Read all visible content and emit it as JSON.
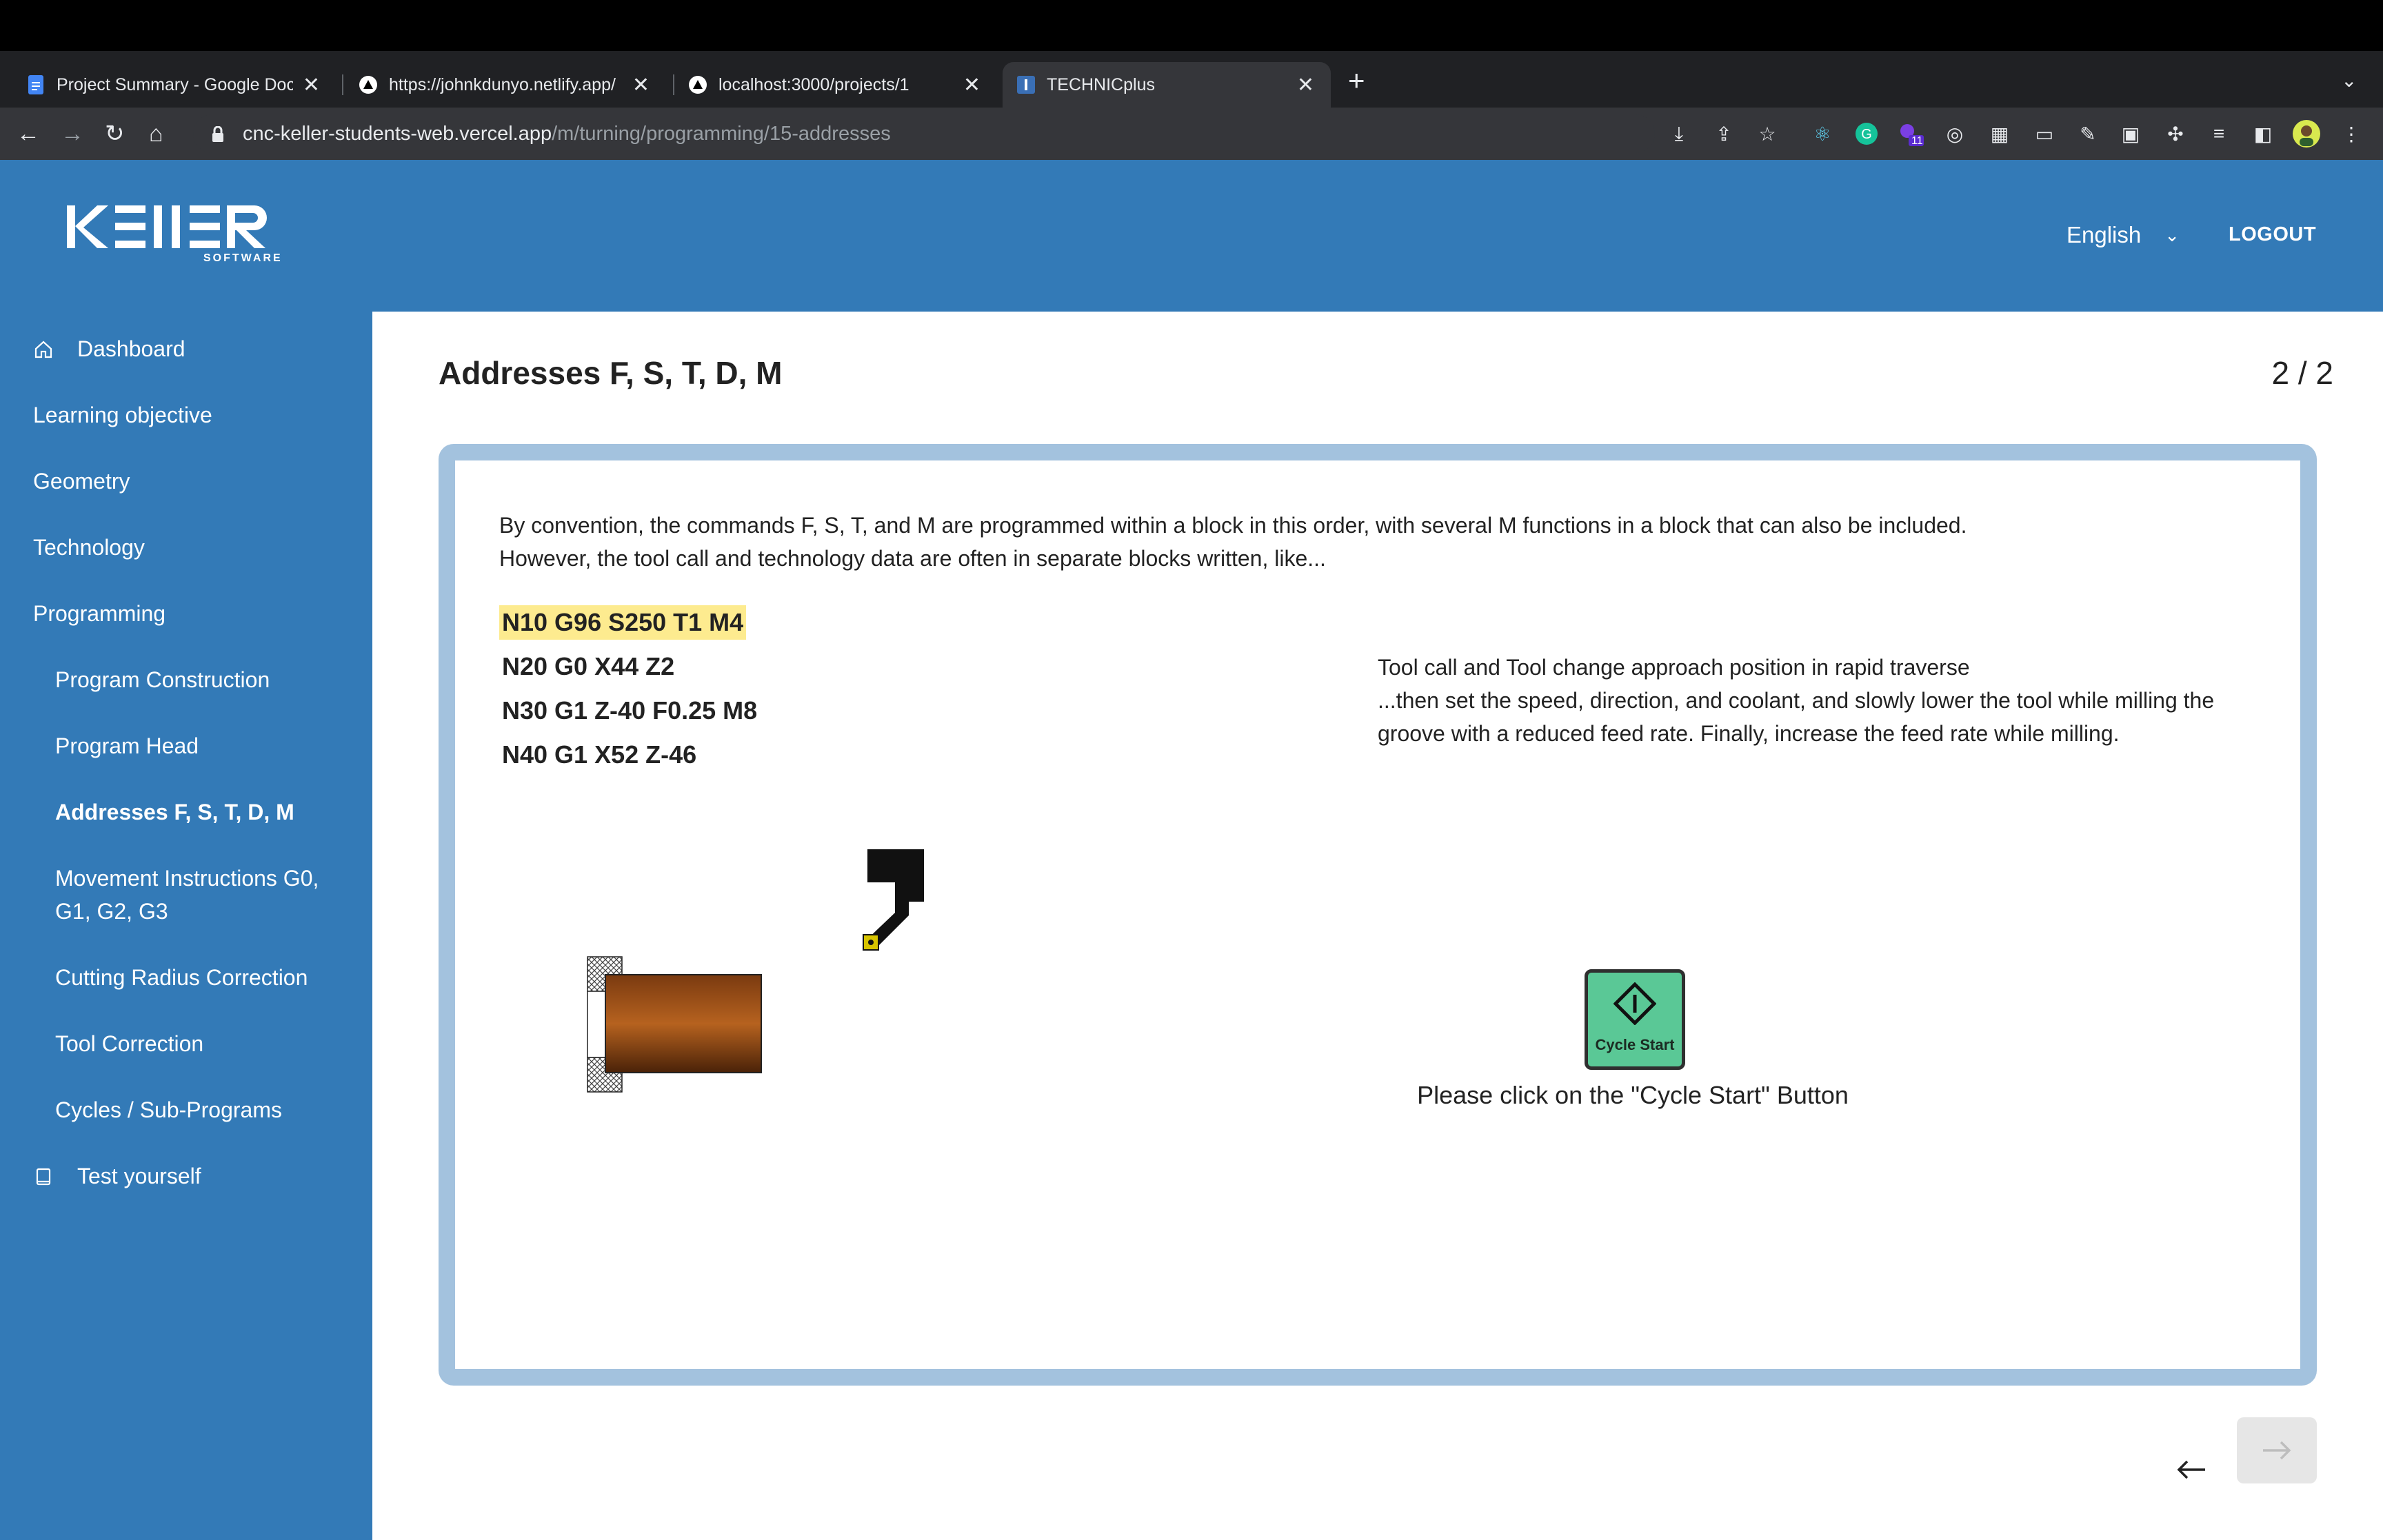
{
  "browser": {
    "tabs": [
      {
        "title": "Project Summary - Google Docs",
        "icon": "google-docs-icon"
      },
      {
        "title": "https://johnkdunyo.netlify.app/",
        "icon": "netlify-icon"
      },
      {
        "title": "localhost:3000/projects/1",
        "icon": "vercel-icon"
      },
      {
        "title": "TECHNICplus",
        "icon": "technicplus-icon"
      }
    ],
    "url_host": "cnc-keller-students-web.vercel.app",
    "url_path": "/m/turning/programming/15-addresses",
    "extension_badge": "11"
  },
  "header": {
    "logo_text": "KELLER",
    "logo_sub": "SOFTWARE",
    "language": "English",
    "logout": "LOGOUT"
  },
  "sidebar": {
    "items": [
      {
        "label": "Dashboard",
        "icon": "home-icon"
      },
      {
        "label": "Learning objective"
      },
      {
        "label": "Geometry"
      },
      {
        "label": "Technology"
      },
      {
        "label": "Programming"
      },
      {
        "label": "Program Construction"
      },
      {
        "label": "Program Head"
      },
      {
        "label": "Addresses F, S, T, D, M"
      },
      {
        "label": "Movement Instructions G0, G1, G2, G3"
      },
      {
        "label": "Cutting Radius Correction"
      },
      {
        "label": "Tool Correction"
      },
      {
        "label": "Cycles / Sub-Programs"
      },
      {
        "label": "Test yourself",
        "icon": "book-icon"
      }
    ]
  },
  "main": {
    "title": "Addresses F, S, T, D, M",
    "page_count": "2 / 2",
    "intro_line1": "By convention, the commands F, S, T, and M are programmed within a block in this order, with several M functions in a block that can also be included.",
    "intro_line2": "However, the tool call and technology data are often in separate blocks written, like...",
    "code": [
      "N10 G96 S250 T1 M4",
      "N20 G0 X44 Z2",
      "N30 G1 Z-40 F0.25 M8",
      "N40 G1 X52 Z-46"
    ],
    "explain_line1": "Tool call and Tool change approach position in rapid traverse",
    "explain_line2": "...then set the speed, direction, and coolant, and slowly lower the tool while milling the groove with a reduced feed rate. Finally, increase the feed rate while milling.",
    "cycle_start_label": "Cycle Start",
    "cycle_hint": "Please click on the \"Cycle Start\" Button"
  },
  "colors": {
    "brand_blue": "#337ab7",
    "frame_border": "#a3c2de",
    "highlight": "#fdeb8f",
    "cycle_green": "#5ac896"
  }
}
